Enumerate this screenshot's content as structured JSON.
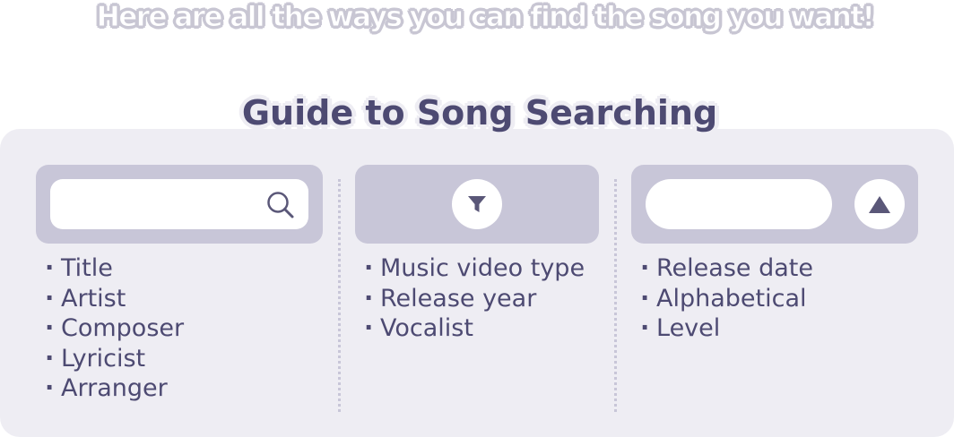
{
  "header": {
    "subtitle": "Here are all the ways you can find the song you want!",
    "title": "Guide to Song Searching"
  },
  "search_section": {
    "icon": "search-icon",
    "items": [
      "Title",
      "Artist",
      "Composer",
      "Lyricist",
      "Arranger"
    ]
  },
  "filter_section": {
    "icon": "filter-icon",
    "items": [
      "Music video type",
      "Release year",
      "Vocalist"
    ]
  },
  "sort_section": {
    "icon": "sort-ascending-icon",
    "items": [
      "Release date",
      "Alphabetical",
      "Level"
    ]
  },
  "bullet": "·",
  "colors": {
    "text": "#4d4a72",
    "panel_bg": "#eeedf3",
    "widget_bg": "#c8c6d8",
    "control_bg": "#ffffff",
    "icon": "#5a5778"
  }
}
